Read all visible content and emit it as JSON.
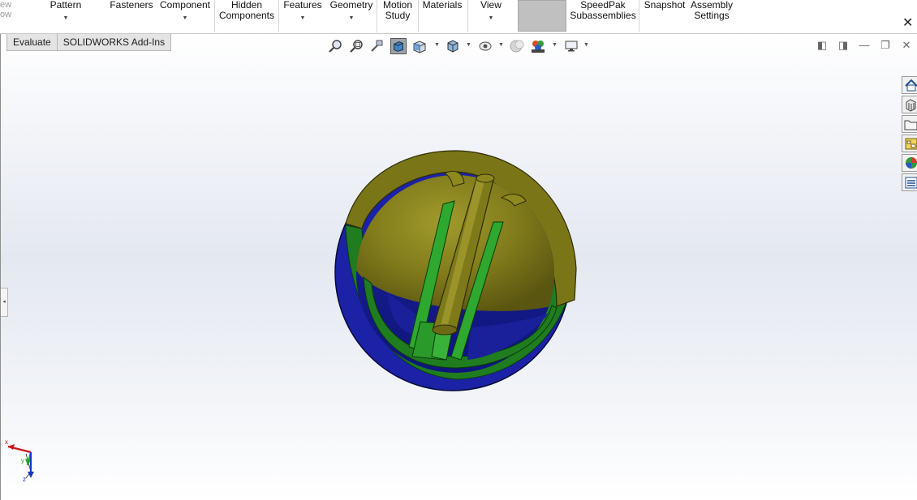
{
  "ribbon": {
    "partial_top": "ew",
    "partial_bottom": "ow",
    "items": [
      {
        "label": "Pattern"
      },
      {
        "label": "Fasteners"
      },
      {
        "label": "Component"
      },
      {
        "label_line1": "Hidden",
        "label_line2": "Components"
      },
      {
        "label": "Features"
      },
      {
        "label": "Geometry"
      },
      {
        "label_line1": "Motion",
        "label_line2": "Study"
      },
      {
        "label": "Materials"
      },
      {
        "label": "View"
      },
      {
        "label_line1": "SpeedPak",
        "label_line2": "Subassemblies"
      },
      {
        "label": "Snapshot"
      },
      {
        "label_line1": "Assembly",
        "label_line2": "Settings"
      }
    ],
    "close_glyph": "✕"
  },
  "tabs": [
    "Evaluate",
    "SOLIDWORKS Add-Ins"
  ],
  "window_controls": {
    "restore_left": "◧",
    "restore_right": "◨",
    "minimize": "—",
    "maximize": "❐",
    "close": "✕"
  },
  "triad": {
    "x": "x",
    "y": "y",
    "z": "z"
  },
  "colors": {
    "olive": "#7a7618",
    "green": "#1f7a1f",
    "blue": "#1a22a0",
    "bright_green": "#2ea82e"
  }
}
